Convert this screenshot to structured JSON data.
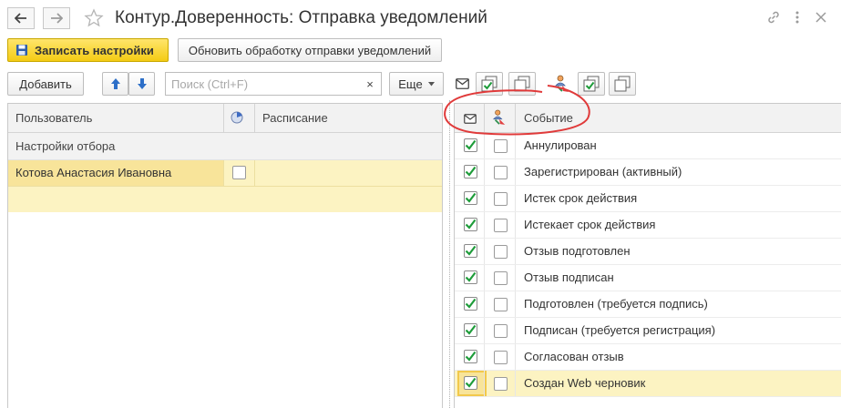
{
  "window": {
    "title": "Контур.Доверенность: Отправка уведомлений",
    "icons": {
      "back": "arrow-left-icon",
      "forward": "arrow-right-icon",
      "favorite": "star-icon",
      "link": "link-icon",
      "more": "more-vertical-icon",
      "close": "close-icon"
    }
  },
  "toolbar": {
    "save_label": "Записать настройки",
    "refresh_label": "Обновить обработку отправки уведомлений"
  },
  "left_panel": {
    "add_label": "Добавить",
    "search_placeholder": "Поиск (Ctrl+F)",
    "search_value": "",
    "clear_glyph": "×",
    "more_label": "Еще",
    "columns": {
      "user": "Пользователь",
      "schedule": "Расписание"
    },
    "group_row": "Настройки отбора",
    "rows": [
      {
        "user": "Котова Анастасия Ивановна",
        "checked": false,
        "schedule": ""
      }
    ]
  },
  "right_panel": {
    "columns": {
      "event": "Событие"
    },
    "events": [
      {
        "label": "Аннулирован",
        "email": true,
        "user": false
      },
      {
        "label": "Зарегистрирован (активный)",
        "email": true,
        "user": false
      },
      {
        "label": "Истек срок действия",
        "email": true,
        "user": false
      },
      {
        "label": "Истекает срок действия",
        "email": true,
        "user": false
      },
      {
        "label": "Отзыв подготовлен",
        "email": true,
        "user": false
      },
      {
        "label": "Отзыв подписан",
        "email": true,
        "user": false
      },
      {
        "label": "Подготовлен (требуется подпись)",
        "email": true,
        "user": false
      },
      {
        "label": "Подписан (требуется регистрация)",
        "email": true,
        "user": false
      },
      {
        "label": "Согласован отзыв",
        "email": true,
        "user": false
      },
      {
        "label": "Создан Web черновик",
        "email": true,
        "user": false,
        "selected": true
      }
    ]
  },
  "colors": {
    "accent_yellow": "#f4cb14",
    "selection": "#fcf3c2",
    "check_green": "#1e9c3a",
    "annotation_red": "#e03a3a"
  }
}
